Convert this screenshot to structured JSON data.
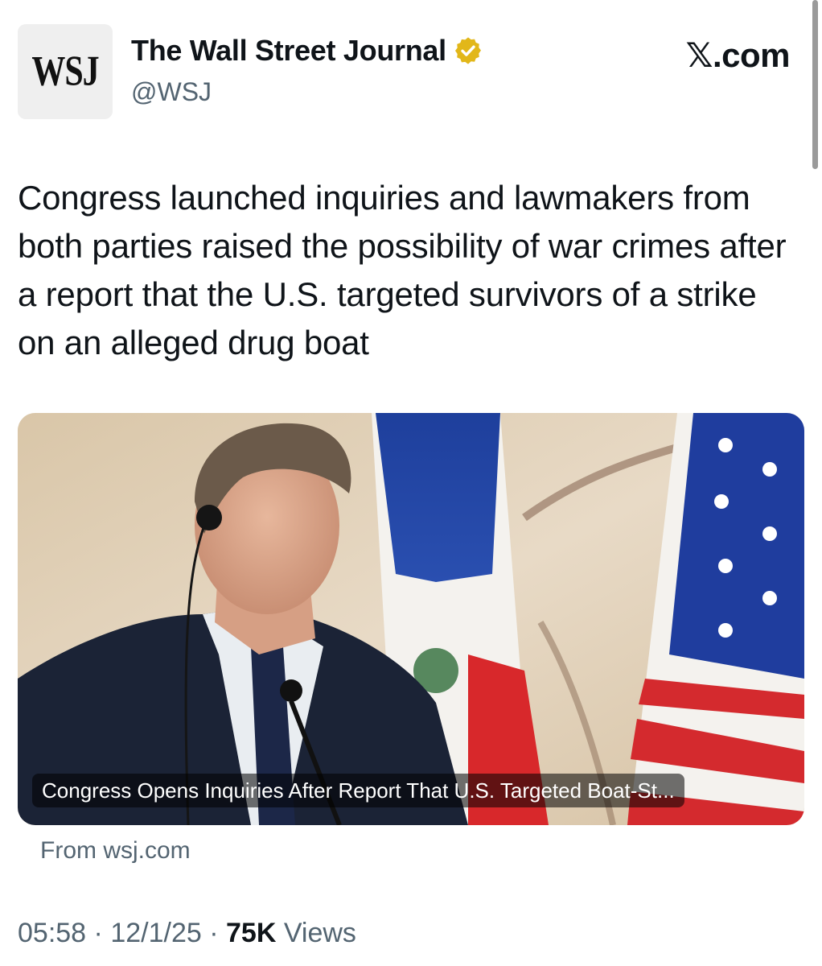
{
  "header": {
    "avatar_text": "WSJ",
    "display_name": "The Wall Street Journal",
    "handle": "@WSJ",
    "source_mark": "𝕏.com"
  },
  "tweet": {
    "text": "Congress launched inquiries and lawmakers from both parties raised the possibility of war crimes after a report that the U.S. targeted survivors of a strike on an alleged drug boat"
  },
  "card": {
    "caption": "Congress Opens Inquiries After Report That U.S. Targeted Boat-St...",
    "domain": "From wsj.com"
  },
  "meta": {
    "time": "05:58",
    "separator": "·",
    "date": "12/1/25",
    "views_count": "75K",
    "views_label": "Views"
  },
  "colors": {
    "verified_badge": "#e2b719",
    "secondary_text": "#536471",
    "primary_text": "#0f1419"
  },
  "icons": {
    "verified": "verified-badge-icon"
  }
}
